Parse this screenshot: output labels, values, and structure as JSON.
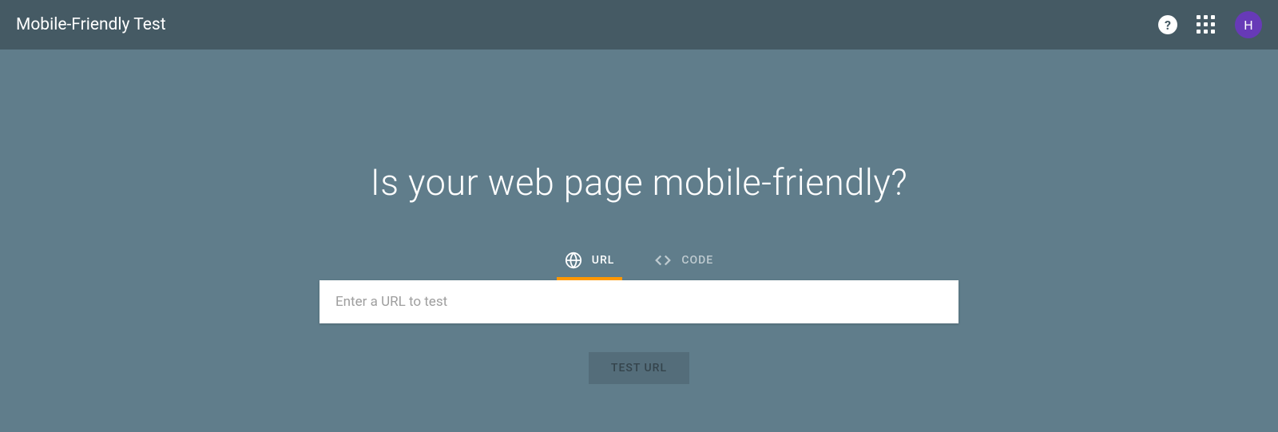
{
  "header": {
    "title": "Mobile-Friendly Test",
    "avatar_initial": "H"
  },
  "main": {
    "headline": "Is your web page mobile-friendly?",
    "tabs": [
      {
        "label": "URL",
        "active": true
      },
      {
        "label": "CODE",
        "active": false
      }
    ],
    "input": {
      "placeholder": "Enter a URL to test",
      "value": ""
    },
    "button_label": "TEST URL"
  }
}
